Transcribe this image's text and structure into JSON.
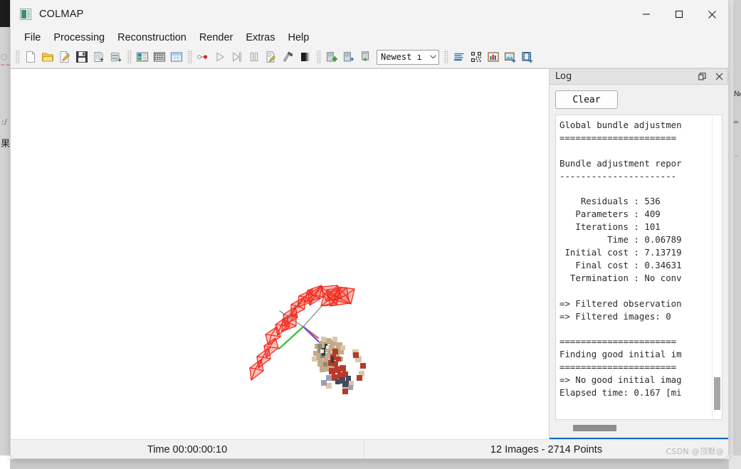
{
  "window": {
    "title": "COLMAP",
    "icon": "colmap-app-icon",
    "controls": [
      {
        "name": "minimize",
        "glyph": "minimize-icon"
      },
      {
        "name": "maximize",
        "glyph": "maximize-icon"
      },
      {
        "name": "close",
        "glyph": "close-icon"
      }
    ]
  },
  "menubar": {
    "items": [
      {
        "label": "File"
      },
      {
        "label": "Processing"
      },
      {
        "label": "Reconstruction"
      },
      {
        "label": "Render"
      },
      {
        "label": "Extras"
      },
      {
        "label": "Help"
      }
    ]
  },
  "toolbar": {
    "groups": [
      {
        "name": "project-group",
        "buttons": [
          {
            "name": "new-project-icon",
            "tip": "New project"
          },
          {
            "name": "open-project-icon",
            "tip": "Open project"
          },
          {
            "name": "edit-project-icon",
            "tip": "Edit project"
          },
          {
            "name": "save-project-icon",
            "tip": "Save project"
          },
          {
            "name": "import-model-icon",
            "tip": "Import model"
          },
          {
            "name": "export-model-icon",
            "tip": "Export model"
          }
        ]
      },
      {
        "name": "database-group",
        "buttons": [
          {
            "name": "feature-extraction-icon",
            "tip": "Feature extraction"
          },
          {
            "name": "feature-matching-icon",
            "tip": "Feature matching"
          },
          {
            "name": "database-management-icon",
            "tip": "Database management"
          }
        ]
      },
      {
        "name": "reconstruction-group",
        "buttons": [
          {
            "name": "automatic-reconstruction-icon",
            "tip": "Automatic reconstruction"
          },
          {
            "name": "start-reconstruction-icon",
            "tip": "Start reconstruction"
          },
          {
            "name": "step-reconstruction-icon",
            "tip": "Reconstruct next image"
          },
          {
            "name": "pause-reconstruction-icon",
            "tip": "Pause reconstruction"
          },
          {
            "name": "bundle-adjustment-icon",
            "tip": "Bundle adjustment"
          },
          {
            "name": "dense-reconstruction-icon",
            "tip": "Dense reconstruction"
          },
          {
            "name": "render-options-icon",
            "tip": "Render options"
          }
        ]
      },
      {
        "name": "model-group",
        "buttons": [
          {
            "name": "add-model-icon",
            "tip": "Add model"
          },
          {
            "name": "next-model-icon",
            "tip": "Next model"
          },
          {
            "name": "previous-model-icon",
            "tip": "Previous model"
          }
        ]
      },
      {
        "name": "view-group",
        "buttons": [
          {
            "name": "show-log-icon",
            "tip": "Show log"
          },
          {
            "name": "match-matrix-icon",
            "tip": "Match matrix"
          },
          {
            "name": "model-statistics-icon",
            "tip": "Model statistics"
          },
          {
            "name": "grab-image-icon",
            "tip": "Grab image"
          },
          {
            "name": "grab-movie-icon",
            "tip": "Grab movie"
          }
        ]
      }
    ],
    "model_select": {
      "value": "Newest ı",
      "arrow": "chevron-down-icon"
    }
  },
  "log_panel": {
    "title": "Log",
    "float_button": "restore-icon",
    "close_button": "close-icon",
    "clear_button_label": "Clear",
    "content": "Global bundle adjustmen\n======================\n\nBundle adjustment repor\n----------------------\n\n    Residuals : 536\n   Parameters : 409\n   Iterations : 101\n         Time : 0.06789\n Initial cost : 7.13719\n   Final cost : 0.34631\n  Termination : No conv\n\n=> Filtered observation\n=> Filtered images: 0\n\n======================\nFinding good initial im\n======================\n=> No good initial imag\nElapsed time: 0.167 [mi",
    "report": {
      "section_title": "Global bundle adjustmen",
      "report_title": "Bundle adjustment repor",
      "residuals_label": "Residuals",
      "residuals": "536",
      "parameters_label": "Parameters",
      "parameters": "409",
      "iterations_label": "Iterations",
      "iterations": "101",
      "time_label": "Time",
      "time": "0.06789",
      "initial_cost_label": "Initial cost",
      "initial_cost": "7.13719",
      "final_cost_label": "Final cost",
      "final_cost": "0.34631",
      "termination_label": "Termination",
      "termination": "No conv",
      "filtered_observations": "=> Filtered observation",
      "filtered_images": "=> Filtered images: 0",
      "finding_initial": "Finding good initial im",
      "no_good_initial": "=> No good initial imag",
      "elapsed": "Elapsed time: 0.167 [mi"
    }
  },
  "viewport": {
    "name": "model-viewer",
    "background_color": "#ffffff",
    "camera_frustum_color": "#f22b1e",
    "axis_colors": {
      "x": "#e03030",
      "y": "#36c23a",
      "z": "#5555ee"
    },
    "point_cloud_colors": [
      "#c8b08c",
      "#b4402f",
      "#8a8272",
      "#d8c7a8",
      "#4a4a58"
    ]
  },
  "statusbar": {
    "time_label": "Time 00:00:00:10",
    "stats_label": "12 Images - 2714 Points",
    "watermark": "CSDN @顶默@"
  }
}
